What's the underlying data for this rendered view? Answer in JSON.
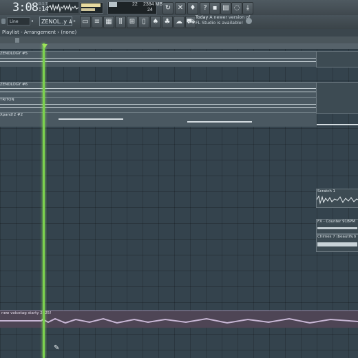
{
  "transport": {
    "time": "3:08",
    "time_sub": ":14",
    "unit": "B:S:T"
  },
  "cpu": {
    "top": "22",
    "ram": "2384 MB",
    "bottom": "24"
  },
  "hint": {
    "title": "Today",
    "message": "A newer version of",
    "message2": "FL Studio is available!"
  },
  "toolbar": {
    "snap": "Line",
    "pattern": "ZENOL..y #10"
  },
  "playlist": {
    "title": "Playlist - Arrangement",
    "sep": "›",
    "sub": "(none)"
  },
  "tracks": [
    {
      "label": "ZENOLOGY #5"
    },
    {
      "label": "ZENOLOGY #6"
    },
    {
      "label": "TRITON"
    },
    {
      "label": "Xpand!2 #2"
    }
  ],
  "clips": [
    {
      "label": "Scratch 1"
    },
    {
      "label": "FX - Counter 91BPM"
    },
    {
      "label": "Chimes 7 (beautiful)"
    }
  ],
  "voice": {
    "label": "new voicetag starty 2025!"
  },
  "colors": {
    "playhead": "#7cd24e",
    "voice": "#4e4555",
    "grid": "#34434d"
  }
}
